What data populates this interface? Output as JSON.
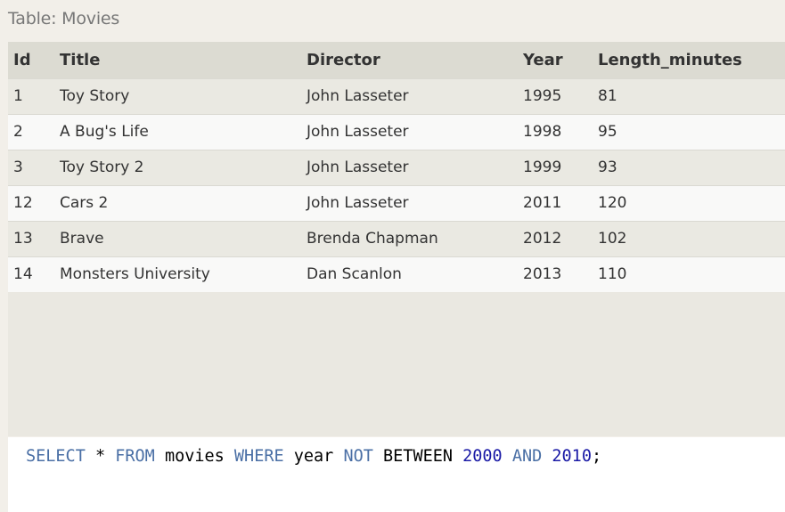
{
  "caption": "Table: Movies",
  "table": {
    "columns": [
      "Id",
      "Title",
      "Director",
      "Year",
      "Length_minutes"
    ],
    "rows": [
      [
        "1",
        "Toy Story",
        "John Lasseter",
        "1995",
        "81"
      ],
      [
        "2",
        "A Bug's Life",
        "John Lasseter",
        "1998",
        "95"
      ],
      [
        "3",
        "Toy Story 2",
        "John Lasseter",
        "1999",
        "93"
      ],
      [
        "12",
        "Cars 2",
        "John Lasseter",
        "2011",
        "120"
      ],
      [
        "13",
        "Brave",
        "Brenda Chapman",
        "2012",
        "102"
      ],
      [
        "14",
        "Monsters University",
        "Dan Scanlon",
        "2013",
        "110"
      ]
    ]
  },
  "query": {
    "select": "SELECT",
    "star": "*",
    "from": "FROM",
    "table": "movies",
    "where": "WHERE",
    "column": "year",
    "not": "NOT",
    "between": "BETWEEN",
    "low": "2000",
    "and": "AND",
    "high": "2010",
    "end": ";"
  },
  "colors": {
    "keyword": "#4a6fa5",
    "number": "#1a1aa6"
  }
}
